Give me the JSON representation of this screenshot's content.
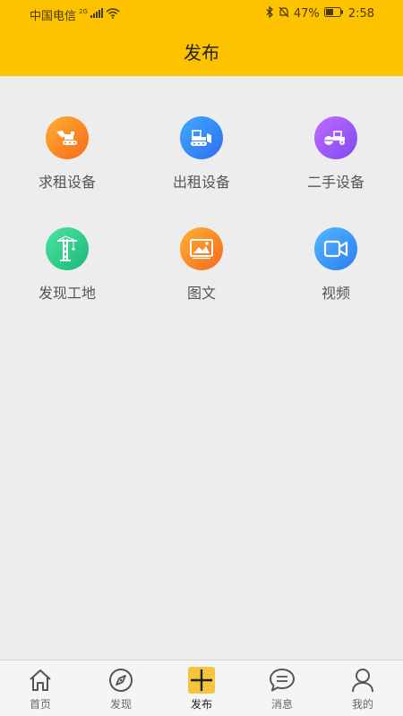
{
  "status_bar": {
    "carrier": "中国电信",
    "network": "2G",
    "battery": "47%",
    "time": "2:58"
  },
  "header": {
    "title": "发布"
  },
  "colors": {
    "header_bg": "#fdc200",
    "page_bg": "#ededed",
    "active_tab": "#f6c33c"
  },
  "grid": [
    {
      "label": "求租设备",
      "icon": "excavator-icon"
    },
    {
      "label": "出租设备",
      "icon": "bulldozer-icon"
    },
    {
      "label": "二手设备",
      "icon": "road-roller-icon"
    },
    {
      "label": "发现工地",
      "icon": "tower-crane-icon"
    },
    {
      "label": "图文",
      "icon": "image-icon"
    },
    {
      "label": "视频",
      "icon": "video-camera-icon"
    }
  ],
  "bottom_nav": [
    {
      "label": "首页",
      "icon": "home-icon"
    },
    {
      "label": "发现",
      "icon": "compass-icon"
    },
    {
      "label": "发布",
      "icon": "publish-plus-icon",
      "active": true
    },
    {
      "label": "消息",
      "icon": "message-icon"
    },
    {
      "label": "我的",
      "icon": "user-icon"
    }
  ]
}
